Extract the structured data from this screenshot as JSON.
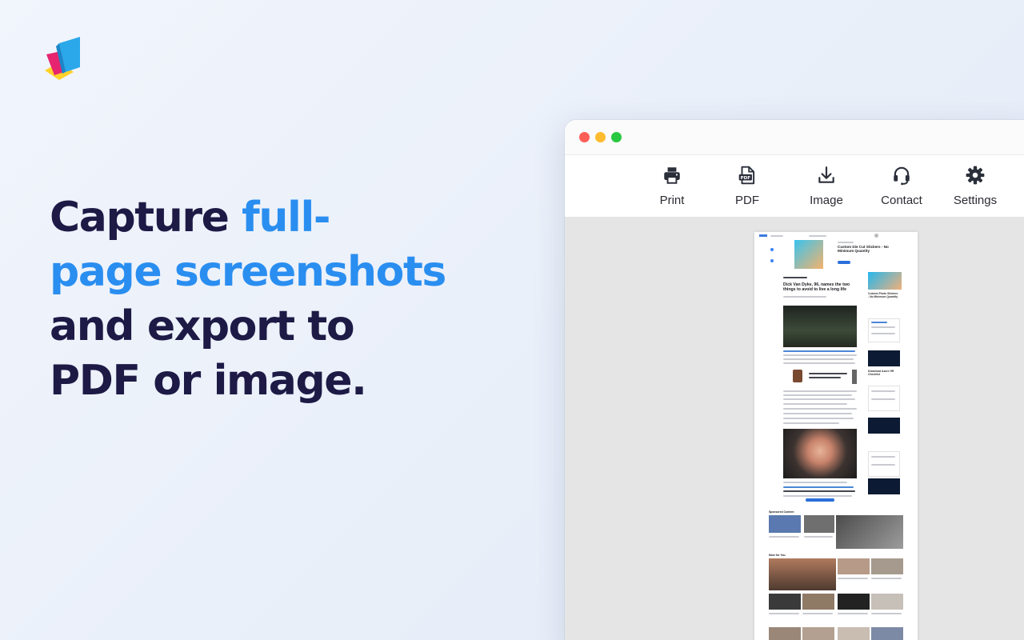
{
  "app": {
    "logo_icon": "layered-pages-logo-icon"
  },
  "headline": {
    "line1_dark": "Capture ",
    "line1_accent": "full-",
    "line2_accent": "page screenshots",
    "line3": "and export to",
    "line4": "PDF or image."
  },
  "colors": {
    "headline_dark": "#1d1a46",
    "headline_accent": "#2a8ef0",
    "window_red": "#fd5f57",
    "window_yellow": "#febc2e",
    "window_green": "#28c840"
  },
  "toolbar": {
    "items": [
      {
        "label": "Print",
        "icon": "printer-icon"
      },
      {
        "label": "PDF",
        "icon": "pdf-file-icon"
      },
      {
        "label": "Image",
        "icon": "download-icon"
      },
      {
        "label": "Contact",
        "icon": "headset-icon"
      },
      {
        "label": "Settings",
        "icon": "gear-icon"
      }
    ]
  },
  "preview": {
    "ad_title": "Custom Die Cut Stickers - No Minimum Quantity",
    "article_title": "Dick Van Dyke, 96, names the two things to avoid to live a long life",
    "side_ad_title": "Custom Photo Stickers - No Minimum Quantity",
    "side_card_title": "Download Azure HR Checklist",
    "section_sponsored": "Sponsored Content",
    "section_more": "More for You"
  }
}
